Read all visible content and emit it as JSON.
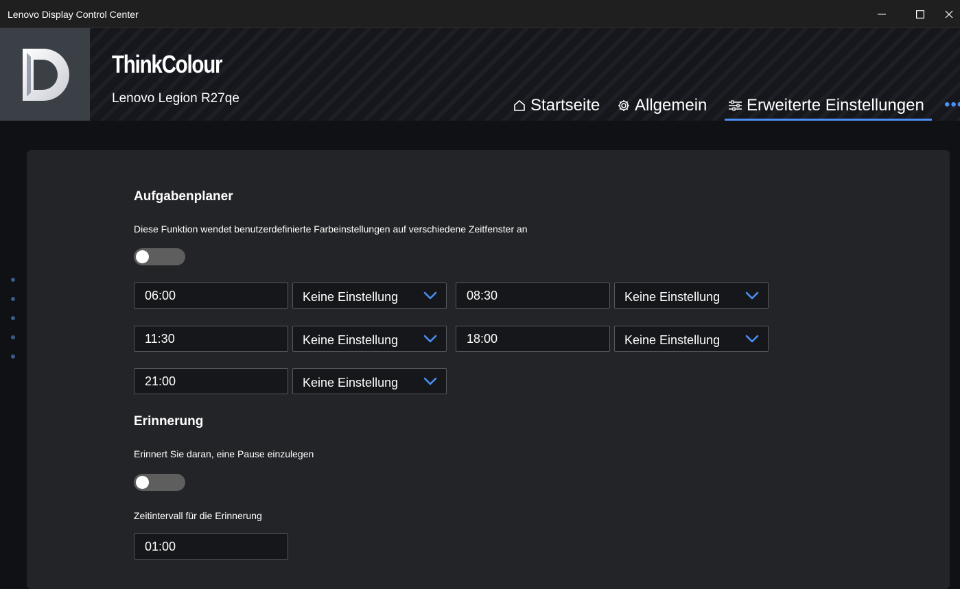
{
  "window": {
    "title": "Lenovo Display Control Center"
  },
  "header": {
    "brand": "ThinkColour",
    "model": "Lenovo Legion R27qe",
    "nav": [
      {
        "label": "Startseite",
        "icon": "home-icon"
      },
      {
        "label": "Allgemein",
        "icon": "gear-icon"
      },
      {
        "label": "Erweiterte Einstellungen",
        "icon": "sliders-icon",
        "active": true
      }
    ],
    "more": "•••"
  },
  "scheduler": {
    "title": "Aufgabenplaner",
    "description": "Diese Funktion wendet benutzerdefinierte Farbeinstellungen auf verschiedene Zeitfenster an",
    "enabled": false,
    "slots": [
      {
        "time": "06:00",
        "mode": "Keine Einstellung"
      },
      {
        "time": "08:30",
        "mode": "Keine Einstellung"
      },
      {
        "time": "11:30",
        "mode": "Keine Einstellung"
      },
      {
        "time": "18:00",
        "mode": "Keine Einstellung"
      },
      {
        "time": "21:00",
        "mode": "Keine Einstellung"
      }
    ]
  },
  "reminder": {
    "title": "Erinnerung",
    "description": "Erinnert Sie daran, eine Pause einzulegen",
    "enabled": false,
    "interval_label": "Zeitintervall für die Erinnerung",
    "interval_value": "01:00"
  },
  "colors": {
    "accent": "#4a90f5",
    "card": "#232427",
    "toggle_off": "#5e5e5e"
  }
}
